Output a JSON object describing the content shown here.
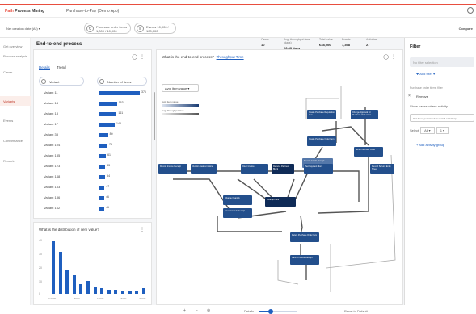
{
  "brand": {
    "logo": "Path",
    "product": "Process Mining"
  },
  "app": {
    "title": "Purchase-to-Pay (Demo App)"
  },
  "filterbar": {
    "left_label": "Net creation date (All) ▾",
    "chips": [
      {
        "icon": "refresh-icon",
        "text": "Purchase order items 1,000 / 10,000"
      },
      {
        "icon": "events-icon",
        "text": "Events 10,000 / 100,000"
      }
    ],
    "compare": "Compare"
  },
  "sidebar": {
    "items": [
      "Get overview",
      "Process analysis",
      "Cases",
      "Variants",
      "Events",
      "Conformance",
      "Rework"
    ],
    "selected": "Variants"
  },
  "page": {
    "title": "End-to-end process"
  },
  "kpis": [
    {
      "label": "Cases",
      "value": "10"
    },
    {
      "label": "Avg. throughput time (days)",
      "value": "26.43 days"
    },
    {
      "label": "Total value",
      "value": "€38,000"
    },
    {
      "label": "Events",
      "value": "1,398"
    },
    {
      "label": "Activities",
      "value": "27"
    }
  ],
  "variants_card": {
    "tabs": [
      {
        "label": "Details"
      },
      {
        "label": "Trend"
      }
    ],
    "col_variant": "Variant ↑",
    "col_count": "Number of items",
    "rows": [
      {
        "label": "Variant 11",
        "value": "376"
      },
      {
        "label": "Variant 14",
        "value": "163"
      },
      {
        "label": "Variant 18",
        "value": "161"
      },
      {
        "label": "Variant 17",
        "value": "143"
      },
      {
        "label": "Variant 33",
        "value": "80"
      },
      {
        "label": "Variant 104",
        "value": "76"
      },
      {
        "label": "Variant 135",
        "value": "61"
      },
      {
        "label": "Variant 123",
        "value": "55"
      },
      {
        "label": "Variant 148",
        "value": "54"
      },
      {
        "label": "Variant 153",
        "value": "47"
      },
      {
        "label": "Variant 186",
        "value": "46"
      },
      {
        "label": "Variant 162",
        "value": "46"
      }
    ]
  },
  "dist_card": {
    "title": "What is the distribution of item value?",
    "y_ticks": [
      "40",
      "30",
      "20",
      "10",
      "0"
    ],
    "x_ticks": [
      "0.0000",
      "5000",
      "10000",
      "15000",
      "20000"
    ],
    "chart_data": {
      "type": "bar",
      "values": [
        37,
        30,
        17,
        13,
        7,
        9,
        5,
        4,
        3,
        3,
        2,
        2,
        2,
        4
      ],
      "ylim": [
        0,
        40
      ]
    }
  },
  "process_card": {
    "title": "What is the end-to-end process?",
    "tab": "Throughput Time",
    "dropdown": "Avg. item value ▾",
    "legend": [
      "Avg. item value",
      "Avg. throughput time"
    ],
    "nodes": [
      "Create Purchase Requisition Item",
      "Change Approval for Purchase Order Item",
      "Create Purchase Order Item",
      "Send Purchase Order",
      "Record Goods Receipt",
      "Record Invoice Receipt",
      "Vendor creates invoice",
      "Clear Invoice",
      "Remove Payment Block",
      "Set Payment Block",
      "Record Service Entry Sheet",
      "Change Quantity",
      "Change Price",
      "Cancel Goods Receipt",
      "Delete Purchase Order Item",
      "Cancel Invoice Receipt"
    ],
    "zoom_in": "+",
    "zoom_out": "−",
    "details": "Details",
    "reset": "Reset to Default"
  },
  "filter": {
    "title": "Filter",
    "search_placeholder": "No filter selection",
    "add": "✚ Add filter ▾",
    "subheading": "Purchase order items filter",
    "section": "Remove",
    "show": "Show cases where activity",
    "input_text": "Has been performed (required activities)",
    "select_label": "Select",
    "select_a": "All ▾",
    "select_b": "1 ▾",
    "group": "+ Add activity group"
  },
  "colors": {
    "accent": "#e84e3f",
    "primary": "#1f5fbf",
    "node": "#234f8c"
  }
}
